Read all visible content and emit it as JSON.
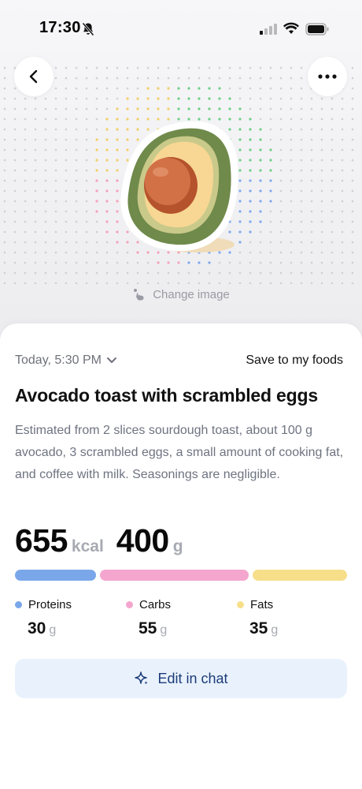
{
  "status_bar": {
    "time": "17:30"
  },
  "header": {
    "back_icon": "chevron-left-icon",
    "more_icon": "ellipsis-icon",
    "change_image_label": "Change image"
  },
  "meal": {
    "date_label": "Today, 5:30 PM",
    "save_label": "Save to my foods",
    "title": "Avocado toast with scrambled eggs",
    "description": "Estimated from 2 slices sourdough toast, about 100 g avocado, 3 scrambled eggs, a small amount of cooking fat, and coffee with milk. Seasonings are negligible.",
    "calories": "655",
    "calories_unit": "kcal",
    "weight": "400",
    "weight_unit": "g"
  },
  "macros": [
    {
      "label": "Proteins",
      "value": "30",
      "unit": "g",
      "color": "#7aa7ea"
    },
    {
      "label": "Carbs",
      "value": "55",
      "unit": "g",
      "color": "#f4a6cf"
    },
    {
      "label": "Fats",
      "value": "35",
      "unit": "g",
      "color": "#f7df8a"
    }
  ],
  "actions": {
    "edit_label": "Edit in chat",
    "edit_icon": "sparkle-icon"
  }
}
